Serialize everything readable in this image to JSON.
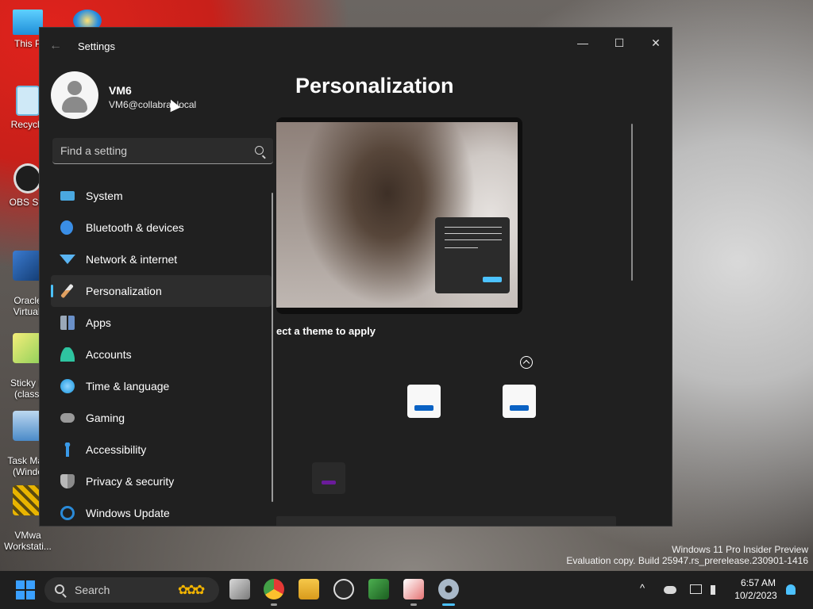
{
  "desktop": {
    "icons": [
      {
        "label": "This P",
        "color": "#38b2e8"
      },
      {
        "label": "Recycle",
        "color": "#9fd4ee"
      },
      {
        "label": "OBS Stu",
        "color": "#222222"
      },
      {
        "label": "Oracle\nVirtuall",
        "color": "#1c4f8f"
      },
      {
        "label": "Sticky N\n(classi",
        "color": "#e6e05a"
      },
      {
        "label": "Task Man\n(Windo",
        "color": "#6fa4d8"
      },
      {
        "label": "VMwa\nWorkstati...",
        "color": "#e8b400"
      }
    ]
  },
  "watermark": {
    "line1": "Windows 11 Pro Insider Preview",
    "line2": "Evaluation copy. Build 25947.rs_prerelease.230901-1416"
  },
  "window": {
    "title": "Settings",
    "back_glyph": "←",
    "minimize_glyph": "—",
    "maximize_glyph": "☐",
    "close_glyph": "✕"
  },
  "profile": {
    "name": "VM6",
    "email": "VM6@collabrat.local"
  },
  "search": {
    "placeholder": "Find a setting"
  },
  "nav": {
    "items": [
      {
        "label": "System",
        "icon": "monitor-icon",
        "color": "#4aa8e0",
        "active": false
      },
      {
        "label": "Bluetooth & devices",
        "icon": "bluetooth-icon",
        "color": "#3a8ee6",
        "active": false
      },
      {
        "label": "Network & internet",
        "icon": "wifi-icon",
        "color": "#5ab4f2",
        "active": false
      },
      {
        "label": "Personalization",
        "icon": "brush-icon",
        "color": "#e0a060",
        "active": true
      },
      {
        "label": "Apps",
        "icon": "apps-icon",
        "color": "#9aa8b8",
        "active": false
      },
      {
        "label": "Accounts",
        "icon": "person-icon",
        "color": "#2ec4a0",
        "active": false
      },
      {
        "label": "Time & language",
        "icon": "globe-clock-icon",
        "color": "#3aa8e8",
        "active": false
      },
      {
        "label": "Gaming",
        "icon": "gamepad-icon",
        "color": "#9a9a9a",
        "active": false
      },
      {
        "label": "Accessibility",
        "icon": "accessibility-icon",
        "color": "#3a9ae8",
        "active": false
      },
      {
        "label": "Privacy & security",
        "icon": "shield-icon",
        "color": "#a0a0a0",
        "active": false
      },
      {
        "label": "Windows Update",
        "icon": "update-icon",
        "color": "#2a8ad8",
        "active": false
      }
    ]
  },
  "main": {
    "title": "Personalization",
    "theme_prompt": "ect a theme to apply"
  },
  "taskbar": {
    "search_label": "Search",
    "clock_time": "6:57 AM",
    "clock_date": "10/2/2023",
    "apps": [
      "task-view-icon",
      "chrome-icon",
      "file-explorer-icon",
      "obs-icon",
      "sheet-app-icon",
      "snipping-tool-icon",
      "settings-icon"
    ]
  },
  "colors": {
    "accent": "#4cc2ff",
    "window_bg": "#202020"
  }
}
